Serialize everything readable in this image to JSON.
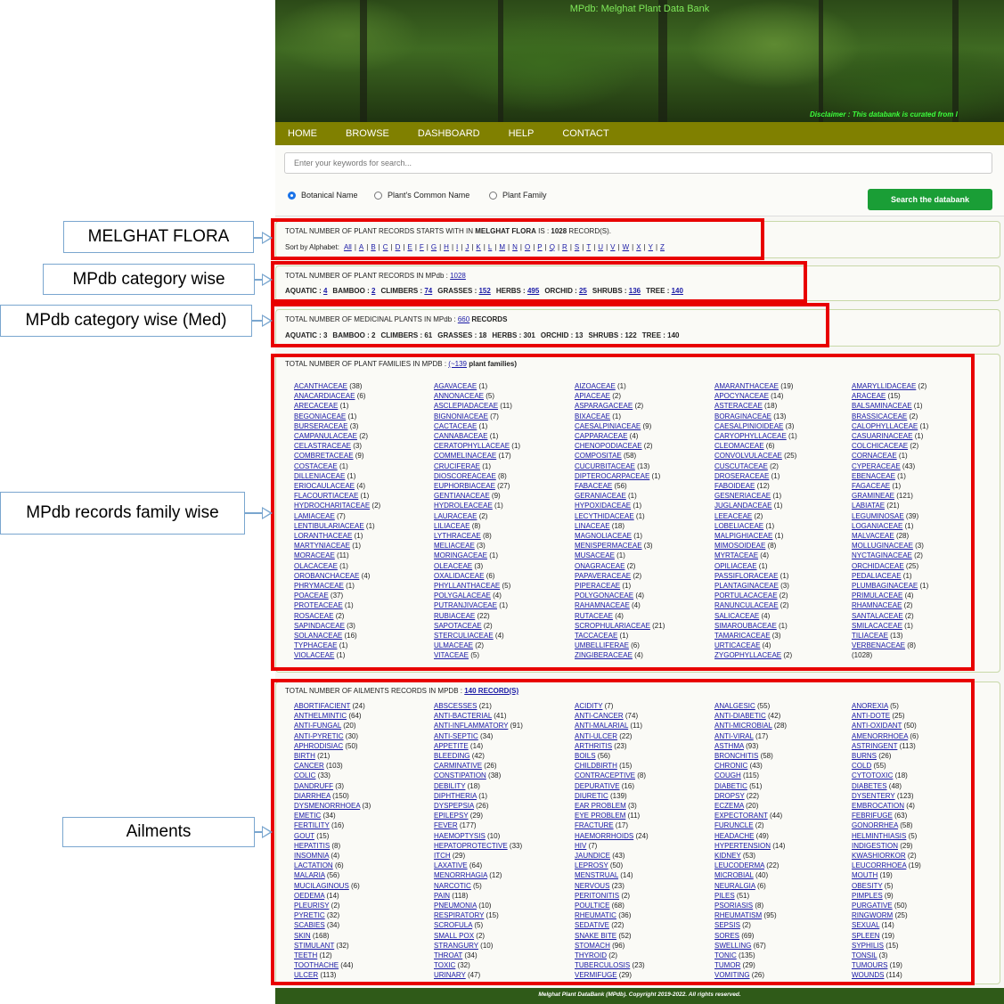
{
  "site": {
    "title": "MPdb: Melghat Plant Data Bank",
    "disclaimer": "Disclaimer : This databank is curated from l",
    "nav": [
      "HOME",
      "BROWSE",
      "DASHBOARD",
      "HELP",
      "CONTACT"
    ],
    "search": {
      "placeholder": "Enter your keywords for search...",
      "options": [
        "Botanical Name",
        "Plant's Common Name",
        "Plant Family"
      ],
      "selected": "Botanical Name",
      "button": "Search the databank"
    },
    "footer": "Melghat Plant DataBank (MPdb). Copyright 2019-2022. All rights reserved."
  },
  "flora": {
    "text_pre": "TOTAL NUMBER OF PLANT RECORDS STARTS WITH IN ",
    "text_bold": "MELGHAT FLORA",
    "text_mid": " IS : ",
    "count": "1028",
    "text_post": " RECORD(S).",
    "sort_label": "Sort by Alphabet:",
    "letters": [
      "All",
      "A",
      "B",
      "C",
      "D",
      "E",
      "F",
      "G",
      "H",
      "I",
      "J",
      "K",
      "L",
      "M",
      "N",
      "O",
      "P",
      "Q",
      "R",
      "S",
      "T",
      "U",
      "V",
      "W",
      "X",
      "Y",
      "Z"
    ]
  },
  "category": {
    "text": "TOTAL NUMBER OF PLANT RECORDS IN MPdb : ",
    "total": "1028",
    "items": [
      [
        "AQUATIC",
        "4"
      ],
      [
        "BAMBOO",
        "2"
      ],
      [
        "CLIMBERS",
        "74"
      ],
      [
        "GRASSES",
        "152"
      ],
      [
        "HERBS",
        "495"
      ],
      [
        "ORCHID",
        "25"
      ],
      [
        "SHRUBS",
        "136"
      ],
      [
        "TREE",
        "140"
      ]
    ]
  },
  "medicinal": {
    "text": "TOTAL NUMBER OF MEDICINAL PLANTS IN MPdb : ",
    "total": "660",
    "text_post": " RECORDS",
    "items": [
      [
        "AQUATIC",
        "3"
      ],
      [
        "BAMBOO",
        "2"
      ],
      [
        "CLIMBERS",
        "61"
      ],
      [
        "GRASSES",
        "18"
      ],
      [
        "HERBS",
        "301"
      ],
      [
        "ORCHID",
        "13"
      ],
      [
        "SHRUBS",
        "122"
      ],
      [
        "TREE",
        "140"
      ]
    ]
  },
  "families": {
    "text": "TOTAL NUMBER OF PLANT FAMILIES IN MPDB : ",
    "link": "(~139",
    "post": " plant families)",
    "total_note": "(1028)",
    "items": [
      [
        "ACANTHACEAE",
        "38"
      ],
      [
        "AGAVACEAE",
        "1"
      ],
      [
        "AIZOACEAE",
        "1"
      ],
      [
        "AMARANTHACEAE",
        "19"
      ],
      [
        "AMARYLLIDACEAE",
        "2"
      ],
      [
        "ANACARDIACEAE",
        "6"
      ],
      [
        "ANNONACEAE",
        "5"
      ],
      [
        "APIACEAE",
        "2"
      ],
      [
        "APOCYNACEAE",
        "14"
      ],
      [
        "ARACEAE",
        "15"
      ],
      [
        "ARECACEAE",
        "1"
      ],
      [
        "ASCLEPIADACEAE",
        "11"
      ],
      [
        "ASPARAGACEAE",
        "2"
      ],
      [
        "ASTERACEAE",
        "18"
      ],
      [
        "BALSAMINACEAE",
        "1"
      ],
      [
        "BEGONIACEAE",
        "1"
      ],
      [
        "BIGNONIACEAE",
        "7"
      ],
      [
        "BIXACEAE",
        "1"
      ],
      [
        "BORAGINACEAE",
        "13"
      ],
      [
        "BRASSICACEAE",
        "2"
      ],
      [
        "BURSERACEAE",
        "3"
      ],
      [
        "CACTACEAE",
        "1"
      ],
      [
        "CAESALPINIACEAE",
        "9"
      ],
      [
        "CAESALPINIOIDEAE",
        "3"
      ],
      [
        "CALOPHYLLACEAE",
        "1"
      ],
      [
        "CAMPANULACEAE",
        "2"
      ],
      [
        "CANNABACEAE",
        "1"
      ],
      [
        "CAPPARACEAE",
        "4"
      ],
      [
        "CARYOPHYLLACEAE",
        "1"
      ],
      [
        "CASUARINACEAE",
        "1"
      ],
      [
        "CELASTRACEAE",
        "3"
      ],
      [
        "CERATOPHYLLACEAE",
        "1"
      ],
      [
        "CHENOPODIACEAE",
        "2"
      ],
      [
        "CLEOMACEAE",
        "6"
      ],
      [
        "COLCHICACEAE",
        "2"
      ],
      [
        "COMBRETACEAE",
        "9"
      ],
      [
        "COMMELINACEAE",
        "17"
      ],
      [
        "COMPOSITAE",
        "58"
      ],
      [
        "CONVOLVULACEAE",
        "25"
      ],
      [
        "CORNACEAE",
        "1"
      ],
      [
        "COSTACEAE",
        "1"
      ],
      [
        "CRUCIFERAE",
        "1"
      ],
      [
        "CUCURBITACEAE",
        "13"
      ],
      [
        "CUSCUTACEAE",
        "2"
      ],
      [
        "CYPERACEAE",
        "43"
      ],
      [
        "DILLENIACEAE",
        "1"
      ],
      [
        "DIOSCOREACEAE",
        "8"
      ],
      [
        "DIPTEROCARPACEAE",
        "1"
      ],
      [
        "DROSERACEAE",
        "1"
      ],
      [
        "EBENACEAE",
        "1"
      ],
      [
        "ERIOCAULACEAE",
        "4"
      ],
      [
        "EUPHORBIACEAE",
        "27"
      ],
      [
        "FABACEAE",
        "56"
      ],
      [
        "FABOIDEAE",
        "12"
      ],
      [
        "FAGACEAE",
        "1"
      ],
      [
        "FLACOURTIACEAE",
        "1"
      ],
      [
        "GENTIANACEAE",
        "9"
      ],
      [
        "GERANIACEAE",
        "1"
      ],
      [
        "GESNERIACEAE",
        "1"
      ],
      [
        "GRAMINEAE",
        "121"
      ],
      [
        "HYDROCHARITACEAE",
        "2"
      ],
      [
        "HYDROLEACEAE",
        "1"
      ],
      [
        "HYPOXIDACEAE",
        "1"
      ],
      [
        "JUGLANDACEAE",
        "1"
      ],
      [
        "LABIATAE",
        "21"
      ],
      [
        "LAMIACEAE",
        "7"
      ],
      [
        "LAURACEAE",
        "2"
      ],
      [
        "LECYTHIDACEAE",
        "1"
      ],
      [
        "LEEACEAE",
        "2"
      ],
      [
        "LEGUMINOSAE",
        "39"
      ],
      [
        "LENTIBULARIACEAE",
        "1"
      ],
      [
        "LILIACEAE",
        "8"
      ],
      [
        "LINACEAE",
        "18"
      ],
      [
        "LOBELIACEAE",
        "1"
      ],
      [
        "LOGANIACEAE",
        "1"
      ],
      [
        "LORANTHACEAE",
        "1"
      ],
      [
        "LYTHRACEAE",
        "8"
      ],
      [
        "MAGNOLIACEAE",
        "1"
      ],
      [
        "MALPIGHIACEAE",
        "1"
      ],
      [
        "MALVACEAE",
        "28"
      ],
      [
        "MARTYNIACEAE",
        "1"
      ],
      [
        "MELIACEAE",
        "3"
      ],
      [
        "MENISPERMACEAE",
        "3"
      ],
      [
        "MIMOSOIDEAE",
        "8"
      ],
      [
        "MOLLUGINACEAE",
        "3"
      ],
      [
        "MORACEAE",
        "11"
      ],
      [
        "MORINGACEAE",
        "1"
      ],
      [
        "MUSACEAE",
        "1"
      ],
      [
        "MYRTACEAE",
        "4"
      ],
      [
        "NYCTAGINACEAE",
        "2"
      ],
      [
        "OLACACEAE",
        "1"
      ],
      [
        "OLEACEAE",
        "3"
      ],
      [
        "ONAGRACEAE",
        "2"
      ],
      [
        "OPILIACEAE",
        "1"
      ],
      [
        "ORCHIDACEAE",
        "25"
      ],
      [
        "OROBANCHACEAE",
        "4"
      ],
      [
        "OXALIDACEAE",
        "6"
      ],
      [
        "PAPAVERACEAE",
        "2"
      ],
      [
        "PASSIFLORACEAE",
        "1"
      ],
      [
        "PEDALIACEAE",
        "1"
      ],
      [
        "PHRYMACEAE",
        "1"
      ],
      [
        "PHYLLANTHACEAE",
        "5"
      ],
      [
        "PIPERACEAE",
        "1"
      ],
      [
        "PLANTAGINACEAE",
        "3"
      ],
      [
        "PLUMBAGINACEAE",
        "1"
      ],
      [
        "POACEAE",
        "37"
      ],
      [
        "POLYGALACEAE",
        "4"
      ],
      [
        "POLYGONACEAE",
        "4"
      ],
      [
        "PORTULACACEAE",
        "2"
      ],
      [
        "PRIMULACEAE",
        "4"
      ],
      [
        "PROTEACEAE",
        "1"
      ],
      [
        "PUTRANJIVACEAE",
        "1"
      ],
      [
        "RAHAMNACEAE",
        "4"
      ],
      [
        "RANUNCULACEAE",
        "2"
      ],
      [
        "RHAMNACEAE",
        "2"
      ],
      [
        "ROSACEAE",
        "2"
      ],
      [
        "RUBIACEAE",
        "22"
      ],
      [
        "RUTACEAE",
        "4"
      ],
      [
        "SALICACEAE",
        "4"
      ],
      [
        "SANTALACEAE",
        "2"
      ],
      [
        "SAPINDACEAE",
        "3"
      ],
      [
        "SAPOTACEAE",
        "2"
      ],
      [
        "SCROPHULARIACEAE",
        "21"
      ],
      [
        "SIMAROUBACEAE",
        "1"
      ],
      [
        "SMILACACEAE",
        "1"
      ],
      [
        "SOLANACEAE",
        "16"
      ],
      [
        "STERCULIACEAE",
        "4"
      ],
      [
        "TACCACEAE",
        "1"
      ],
      [
        "TAMARICACEAE",
        "3"
      ],
      [
        "TILIACEAE",
        "13"
      ],
      [
        "TYPHACEAE",
        "1"
      ],
      [
        "ULMACEAE",
        "2"
      ],
      [
        "UMBELLIFERAE",
        "6"
      ],
      [
        "URTICACEAE",
        "4"
      ],
      [
        "VERBENACEAE",
        "8"
      ],
      [
        "VIOLACEAE",
        "1"
      ],
      [
        "VITACEAE",
        "5"
      ],
      [
        "ZINGIBERACEAE",
        "4"
      ],
      [
        "ZYGOPHYLLACEAE",
        "2"
      ]
    ]
  },
  "ailments": {
    "text": "TOTAL NUMBER OF AILMENTS RECORDS IN MPDB : ",
    "link": "140 RECORD(S)",
    "items": [
      [
        "ABORTIFACIENT",
        "24"
      ],
      [
        "ABSCESSES",
        "21"
      ],
      [
        "ACIDITY",
        "7"
      ],
      [
        "ANALGESIC",
        "55"
      ],
      [
        "ANOREXIA",
        "5"
      ],
      [
        "ANTHELMINTIC",
        "64"
      ],
      [
        "ANTI-BACTERIAL",
        "41"
      ],
      [
        "ANTI-CANCER",
        "74"
      ],
      [
        "ANTI-DIABETIC",
        "42"
      ],
      [
        "ANTI-DOTE",
        "25"
      ],
      [
        "ANTI-FUNGAL",
        "20"
      ],
      [
        "ANTI-INFLAMMATORY",
        "91"
      ],
      [
        "ANTI-MALARIAL",
        "11"
      ],
      [
        "ANTI-MICROBIAL",
        "28"
      ],
      [
        "ANTI-OXIDANT",
        "50"
      ],
      [
        "ANTI-PYRETIC",
        "30"
      ],
      [
        "ANTI-SEPTIC",
        "34"
      ],
      [
        "ANTI-ULCER",
        "22"
      ],
      [
        "ANTI-VIRAL",
        "17"
      ],
      [
        "AMENORRHOEA",
        "6"
      ],
      [
        "APHRODISIAC",
        "50"
      ],
      [
        "APPETITE",
        "14"
      ],
      [
        "ARTHRITIS",
        "23"
      ],
      [
        "ASTHMA",
        "93"
      ],
      [
        "ASTRINGENT",
        "113"
      ],
      [
        "BIRTH",
        "21"
      ],
      [
        "BLEEDING",
        "42"
      ],
      [
        "BOILS",
        "56"
      ],
      [
        "BRONCHITIS",
        "58"
      ],
      [
        "BURNS",
        "26"
      ],
      [
        "CANCER",
        "103"
      ],
      [
        "CARMINATIVE",
        "26"
      ],
      [
        "CHILDBIRTH",
        "15"
      ],
      [
        "CHRONIC",
        "43"
      ],
      [
        "COLD",
        "55"
      ],
      [
        "COLIC",
        "33"
      ],
      [
        "CONSTIPATION",
        "38"
      ],
      [
        "CONTRACEPTIVE",
        "8"
      ],
      [
        "COUGH",
        "115"
      ],
      [
        "CYTOTOXIC",
        "18"
      ],
      [
        "DANDRUFF",
        "3"
      ],
      [
        "DEBILITY",
        "18"
      ],
      [
        "DEPURATIVE",
        "16"
      ],
      [
        "DIABETIC",
        "51"
      ],
      [
        "DIABETES",
        "48"
      ],
      [
        "DIARRHEA",
        "150"
      ],
      [
        "DIPHTHERIA",
        "1"
      ],
      [
        "DIURETIC",
        "139"
      ],
      [
        "DROPSY",
        "22"
      ],
      [
        "DYSENTERY",
        "123"
      ],
      [
        "DYSMENORRHOEA",
        "3"
      ],
      [
        "DYSPEPSIA",
        "26"
      ],
      [
        "EAR PROBLEM",
        "3"
      ],
      [
        "ECZEMA",
        "20"
      ],
      [
        "EMBROCATION",
        "4"
      ],
      [
        "EMETIC",
        "34"
      ],
      [
        "EPILEPSY",
        "29"
      ],
      [
        "EYE PROBLEM",
        "11"
      ],
      [
        "EXPECTORANT",
        "44"
      ],
      [
        "FEBRIFUGE",
        "63"
      ],
      [
        "FERTILITY",
        "16"
      ],
      [
        "FEVER",
        "177"
      ],
      [
        "FRACTURE",
        "17"
      ],
      [
        "FURUNCLE",
        "2"
      ],
      [
        "GONORRHEA",
        "58"
      ],
      [
        "GOUT",
        "15"
      ],
      [
        "HAEMOPTYSIS",
        "10"
      ],
      [
        "HAEMORRHOIDS",
        "24"
      ],
      [
        "HEADACHE",
        "49"
      ],
      [
        "HELMINTHIASIS",
        "5"
      ],
      [
        "HEPATITIS",
        "8"
      ],
      [
        "HEPATOPROTECTIVE",
        "33"
      ],
      [
        "HIV",
        "7"
      ],
      [
        "HYPERTENSION",
        "14"
      ],
      [
        "INDIGESTION",
        "29"
      ],
      [
        "INSOMNIA",
        "4"
      ],
      [
        "ITCH",
        "29"
      ],
      [
        "JAUNDICE",
        "43"
      ],
      [
        "KIDNEY",
        "53"
      ],
      [
        "KWASHIORKOR",
        "2"
      ],
      [
        "LACTATION",
        "6"
      ],
      [
        "LAXATIVE",
        "64"
      ],
      [
        "LEPROSY",
        "50"
      ],
      [
        "LEUCODERMA",
        "22"
      ],
      [
        "LEUCORRHOEA",
        "19"
      ],
      [
        "MALARIA",
        "56"
      ],
      [
        "MENORRHAGIA",
        "12"
      ],
      [
        "MENSTRUAL",
        "14"
      ],
      [
        "MICROBIAL",
        "40"
      ],
      [
        "MOUTH",
        "19"
      ],
      [
        "MUCILAGINOUS",
        "6"
      ],
      [
        "NARCOTIC",
        "5"
      ],
      [
        "NERVOUS",
        "23"
      ],
      [
        "NEURALGIA",
        "6"
      ],
      [
        "OBESITY",
        "5"
      ],
      [
        "OEDEMA",
        "14"
      ],
      [
        "PAIN",
        "118"
      ],
      [
        "PERITONITIS",
        "2"
      ],
      [
        "PILES",
        "51"
      ],
      [
        "PIMPLES",
        "9"
      ],
      [
        "PLEURISY",
        "2"
      ],
      [
        "PNEUMONIA",
        "10"
      ],
      [
        "POULTICE",
        "68"
      ],
      [
        "PSORIASIS",
        "8"
      ],
      [
        "PURGATIVE",
        "50"
      ],
      [
        "PYRETIC",
        "32"
      ],
      [
        "RESPIRATORY",
        "15"
      ],
      [
        "RHEUMATIC",
        "36"
      ],
      [
        "RHEUMATISM",
        "95"
      ],
      [
        "RINGWORM",
        "25"
      ],
      [
        "SCABIES",
        "34"
      ],
      [
        "SCROFULA",
        "5"
      ],
      [
        "SEDATIVE",
        "22"
      ],
      [
        "SEPSIS",
        "2"
      ],
      [
        "SEXUAL",
        "14"
      ],
      [
        "SKIN",
        "168"
      ],
      [
        "SMALL POX",
        "2"
      ],
      [
        "SNAKE BITE",
        "52"
      ],
      [
        "SORES",
        "69"
      ],
      [
        "SPLEEN",
        "19"
      ],
      [
        "STIMULANT",
        "32"
      ],
      [
        "STRANGURY",
        "10"
      ],
      [
        "STOMACH",
        "96"
      ],
      [
        "SWELLING",
        "67"
      ],
      [
        "SYPHILIS",
        "15"
      ],
      [
        "TEETH",
        "12"
      ],
      [
        "THROAT",
        "34"
      ],
      [
        "THYROID",
        "2"
      ],
      [
        "TONIC",
        "135"
      ],
      [
        "TONSIL",
        "3"
      ],
      [
        "TOOTHACHE",
        "44"
      ],
      [
        "TOXIC",
        "32"
      ],
      [
        "TUBERCULOSIS",
        "23"
      ],
      [
        "TUMOR",
        "29"
      ],
      [
        "TUMOURS",
        "19"
      ],
      [
        "ULCER",
        "113"
      ],
      [
        "URINARY",
        "47"
      ],
      [
        "VERMIFUGE",
        "29"
      ],
      [
        "VOMITING",
        "26"
      ],
      [
        "WOUNDS",
        "114"
      ]
    ]
  },
  "callouts": [
    "MELGHAT FLORA",
    "MPdb category wise",
    "MPdb category wise (Med)",
    "MPdb records family wise",
    "Ailments"
  ],
  "colors": {
    "nav": "#808000",
    "accent_button": "#1a9e36",
    "highlight_box": "#e80000",
    "link": "#1a1aa6",
    "callout_border": "#7aa6cf"
  }
}
